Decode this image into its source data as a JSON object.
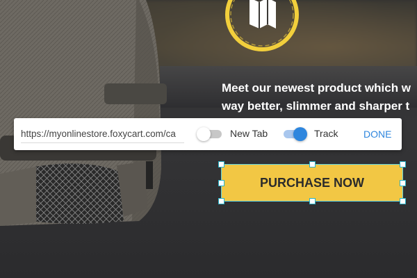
{
  "hero": {
    "headline_lines": [
      "Meet our newest product which w",
      "way better, slimmer and sharper t"
    ]
  },
  "link_editor": {
    "url_value": "https://myonlinestore.foxycart.com/ca",
    "new_tab": {
      "label": "New Tab",
      "checked": false
    },
    "track": {
      "label": "Track",
      "checked": true
    },
    "done_label": "DONE"
  },
  "purchase": {
    "label": "PURCHASE NOW",
    "selected": true
  },
  "colors": {
    "accent_blue": "#2e86de",
    "button_yellow": "#f2c744",
    "selection_cyan": "#27b3c9",
    "logo_yellow": "#f2cf3c"
  },
  "icons": {
    "logo": "folded-map-icon"
  }
}
